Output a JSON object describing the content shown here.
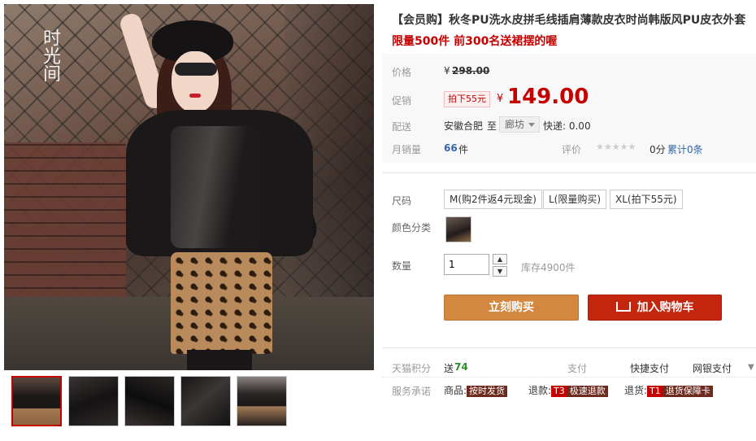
{
  "product": {
    "title": "【会员购】秋冬PU洗水皮拼毛线插肩薄款皮衣时尚韩版风PU皮衣外套",
    "subtitle": "限量500件 前300名送裙摆的喔"
  },
  "price": {
    "label": "价格",
    "currency": "¥",
    "original": "298.00"
  },
  "promo": {
    "label": "促销",
    "tag": "拍下55元",
    "currency": "¥",
    "price": "149.00"
  },
  "delivery": {
    "label": "配送",
    "from": "安徽合肥",
    "to_word": "至",
    "destination": "廊坊",
    "shipping": "快递: 0.00"
  },
  "sales": {
    "label": "月销量",
    "count": "66",
    "unit": "件",
    "rating_label": "评价",
    "stars": "★★★★★",
    "score": "0分",
    "reviews_link": "累计0条"
  },
  "size": {
    "label": "尺码",
    "options": [
      "M(购2件返4元现金)",
      "L(限量购买)",
      "XL(拍下55元)"
    ]
  },
  "color": {
    "label": "颜色分类"
  },
  "quantity": {
    "label": "数量",
    "value": "1",
    "up": "▲",
    "down": "▼",
    "stock": "库存4900件"
  },
  "actions": {
    "buy_now": "立刻购买",
    "add_to_cart": "加入购物车"
  },
  "points": {
    "label": "天猫积分",
    "prefix": "送",
    "value": "74",
    "pay_label": "支付",
    "pay_options": [
      "快捷支付",
      "网银支付"
    ]
  },
  "service": {
    "label": "服务承诺",
    "goods_prefix": "商品:",
    "goods_tag": "按时发货",
    "refund_prefix": "退款:",
    "refund_code": "T3",
    "refund_tag": "极速退款",
    "return_prefix": "退货:",
    "return_code": "T1",
    "return_tag": "退货保障卡"
  },
  "photo": {
    "stamp": "时光间"
  },
  "colors": {
    "accent_red": "#c40000",
    "buy_now_orange": "#d4873f",
    "cart_red": "#c4260d",
    "link_blue": "#3366aa"
  }
}
